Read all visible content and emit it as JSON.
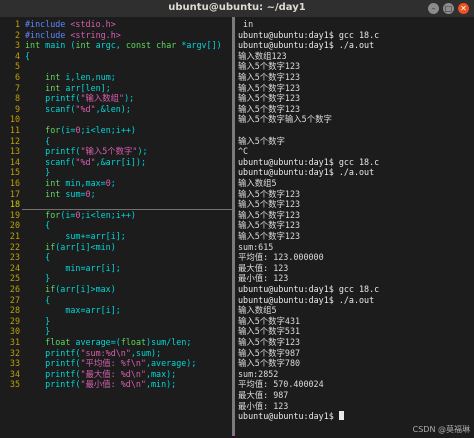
{
  "window": {
    "title": "ubuntu@ubuntu: ~/day1",
    "close_glyph": "✕",
    "maximize_glyph": "□",
    "minimize_glyph": "–"
  },
  "editor": {
    "lines": [
      {
        "n": "1",
        "segs": [
          [
            "pp",
            "#include "
          ],
          [
            "str",
            "<stdio.h>"
          ]
        ]
      },
      {
        "n": "2",
        "segs": [
          [
            "pp",
            "#include "
          ],
          [
            "str",
            "<string.h>"
          ]
        ]
      },
      {
        "n": "3",
        "segs": [
          [
            "kw",
            "int"
          ],
          [
            "plain",
            " main ("
          ],
          [
            "kw",
            "int"
          ],
          [
            "plain",
            " argc, "
          ],
          [
            "kw",
            "const char"
          ],
          [
            "plain",
            " *argv[])"
          ]
        ]
      },
      {
        "n": "4",
        "segs": [
          [
            "plain",
            "{"
          ]
        ]
      },
      {
        "n": "5",
        "segs": []
      },
      {
        "n": "6",
        "segs": [
          [
            "plain",
            "    "
          ],
          [
            "kw",
            "int"
          ],
          [
            "plain",
            " i,len,num;"
          ]
        ]
      },
      {
        "n": "7",
        "segs": [
          [
            "plain",
            "    "
          ],
          [
            "kw",
            "int"
          ],
          [
            "plain",
            " arr[len];"
          ]
        ]
      },
      {
        "n": "8",
        "segs": [
          [
            "plain",
            "    printf("
          ],
          [
            "str",
            "\"输入数组\""
          ],
          [
            "plain",
            ");"
          ]
        ]
      },
      {
        "n": "9",
        "segs": [
          [
            "plain",
            "    scanf("
          ],
          [
            "str",
            "\"%d\""
          ],
          [
            "plain",
            ",&len);"
          ]
        ]
      },
      {
        "n": "10",
        "segs": []
      },
      {
        "n": "11",
        "segs": [
          [
            "plain",
            "    "
          ],
          [
            "kw",
            "for"
          ],
          [
            "plain",
            "(i="
          ],
          [
            "num",
            "0"
          ],
          [
            "plain",
            ";i<len;i++)"
          ]
        ]
      },
      {
        "n": "12",
        "segs": [
          [
            "plain",
            "    {"
          ]
        ]
      },
      {
        "n": "13",
        "segs": [
          [
            "plain",
            "    printf("
          ],
          [
            "str",
            "\"输入5个数字\""
          ],
          [
            "plain",
            ");"
          ]
        ]
      },
      {
        "n": "14",
        "segs": [
          [
            "plain",
            "    scanf("
          ],
          [
            "str",
            "\"%d\""
          ],
          [
            "plain",
            ",&arr[i]);"
          ]
        ]
      },
      {
        "n": "15",
        "segs": [
          [
            "plain",
            "    }"
          ]
        ]
      },
      {
        "n": "16",
        "segs": [
          [
            "plain",
            "    "
          ],
          [
            "kw",
            "int"
          ],
          [
            "plain",
            " min,max="
          ],
          [
            "num",
            "0"
          ],
          [
            "plain",
            ";"
          ]
        ]
      },
      {
        "n": "17",
        "segs": [
          [
            "plain",
            "    "
          ],
          [
            "kw",
            "int"
          ],
          [
            "plain",
            " sum="
          ],
          [
            "num",
            "0"
          ],
          [
            "plain",
            ";"
          ]
        ]
      },
      {
        "n": "18",
        "segs": []
      },
      {
        "n": "19",
        "segs": [
          [
            "plain",
            "    "
          ],
          [
            "kw",
            "for"
          ],
          [
            "plain",
            "(i="
          ],
          [
            "num",
            "0"
          ],
          [
            "plain",
            ";i<len;i++)"
          ]
        ]
      },
      {
        "n": "20",
        "segs": [
          [
            "plain",
            "    {"
          ]
        ]
      },
      {
        "n": "21",
        "segs": [
          [
            "plain",
            "        sum+=arr[i];"
          ]
        ]
      },
      {
        "n": "22",
        "segs": [
          [
            "plain",
            "    "
          ],
          [
            "kw",
            "if"
          ],
          [
            "plain",
            "(arr[i]<min)"
          ]
        ]
      },
      {
        "n": "23",
        "segs": [
          [
            "plain",
            "    {"
          ]
        ]
      },
      {
        "n": "24",
        "segs": [
          [
            "plain",
            "        min=arr[i];"
          ]
        ]
      },
      {
        "n": "25",
        "segs": [
          [
            "plain",
            "    }"
          ]
        ]
      },
      {
        "n": "26",
        "segs": [
          [
            "plain",
            "    "
          ],
          [
            "kw",
            "if"
          ],
          [
            "plain",
            "(arr[i]>max)"
          ]
        ]
      },
      {
        "n": "27",
        "segs": [
          [
            "plain",
            "    {"
          ]
        ]
      },
      {
        "n": "28",
        "segs": [
          [
            "plain",
            "        max=arr[i];"
          ]
        ]
      },
      {
        "n": "29",
        "segs": [
          [
            "plain",
            "    }"
          ]
        ]
      },
      {
        "n": "30",
        "segs": [
          [
            "plain",
            "    }"
          ]
        ]
      },
      {
        "n": "31",
        "segs": [
          [
            "plain",
            "    "
          ],
          [
            "kw",
            "float"
          ],
          [
            "plain",
            " average=("
          ],
          [
            "kw",
            "float"
          ],
          [
            "plain",
            ")sum/len;"
          ]
        ]
      },
      {
        "n": "32",
        "segs": [
          [
            "plain",
            "    printf("
          ],
          [
            "str",
            "\"sum:%d\\n\""
          ],
          [
            "plain",
            ",sum);"
          ]
        ]
      },
      {
        "n": "33",
        "segs": [
          [
            "plain",
            "    printf("
          ],
          [
            "str",
            "\"平均值: %f\\n\""
          ],
          [
            "plain",
            ",average);"
          ]
        ]
      },
      {
        "n": "34",
        "segs": [
          [
            "plain",
            "    printf("
          ],
          [
            "str",
            "\"最大值: %d\\n\""
          ],
          [
            "plain",
            ",max);"
          ]
        ]
      },
      {
        "n": "35",
        "segs": [
          [
            "plain",
            "    printf("
          ],
          [
            "str",
            "\"最小值: %d\\n\""
          ],
          [
            "plain",
            ",min);"
          ]
        ]
      }
    ],
    "current_line": "18",
    "status": {
      "file": "18.c",
      "position": "18,0-1",
      "percent": "顶端"
    }
  },
  "terminal": {
    "lines": [
      " in",
      "ubuntu@ubuntu:day1$ gcc 18.c",
      "ubuntu@ubuntu:day1$ ./a.out",
      "输入数组123",
      "输入5个数字123",
      "输入5个数字123",
      "输入5个数字123",
      "输入5个数字123",
      "输入5个数字123",
      "输入5个数字输入5个数字",
      "",
      "输入5个数字",
      "^C",
      "ubuntu@ubuntu:day1$ gcc 18.c",
      "ubuntu@ubuntu:day1$ ./a.out",
      "输入数组5",
      "输入5个数字123",
      "输入5个数字123",
      "输入5个数字123",
      "输入5个数字123",
      "输入5个数字123",
      "sum:615",
      "平均值: 123.000000",
      "最大值: 123",
      "最小值: 123",
      "ubuntu@ubuntu:day1$ gcc 18.c",
      "ubuntu@ubuntu:day1$ ./a.out",
      "输入数组5",
      "输入5个数字431",
      "输入5个数字531",
      "输入5个数字123",
      "输入5个数字987",
      "输入5个数字780",
      "sum:2852",
      "平均值: 570.400024",
      "最大值: 987",
      "最小值: 123"
    ],
    "final_prompt": "ubuntu@ubuntu:day1$ ",
    "watermark": "CSDN @莫福琳"
  },
  "colors": {
    "background": "#1c1c1c",
    "line_number": "#c0a000",
    "keyword": "#5fd75f",
    "string": "#d75faf",
    "preprocessor": "#5f87ff",
    "code": "#00d7d7"
  }
}
